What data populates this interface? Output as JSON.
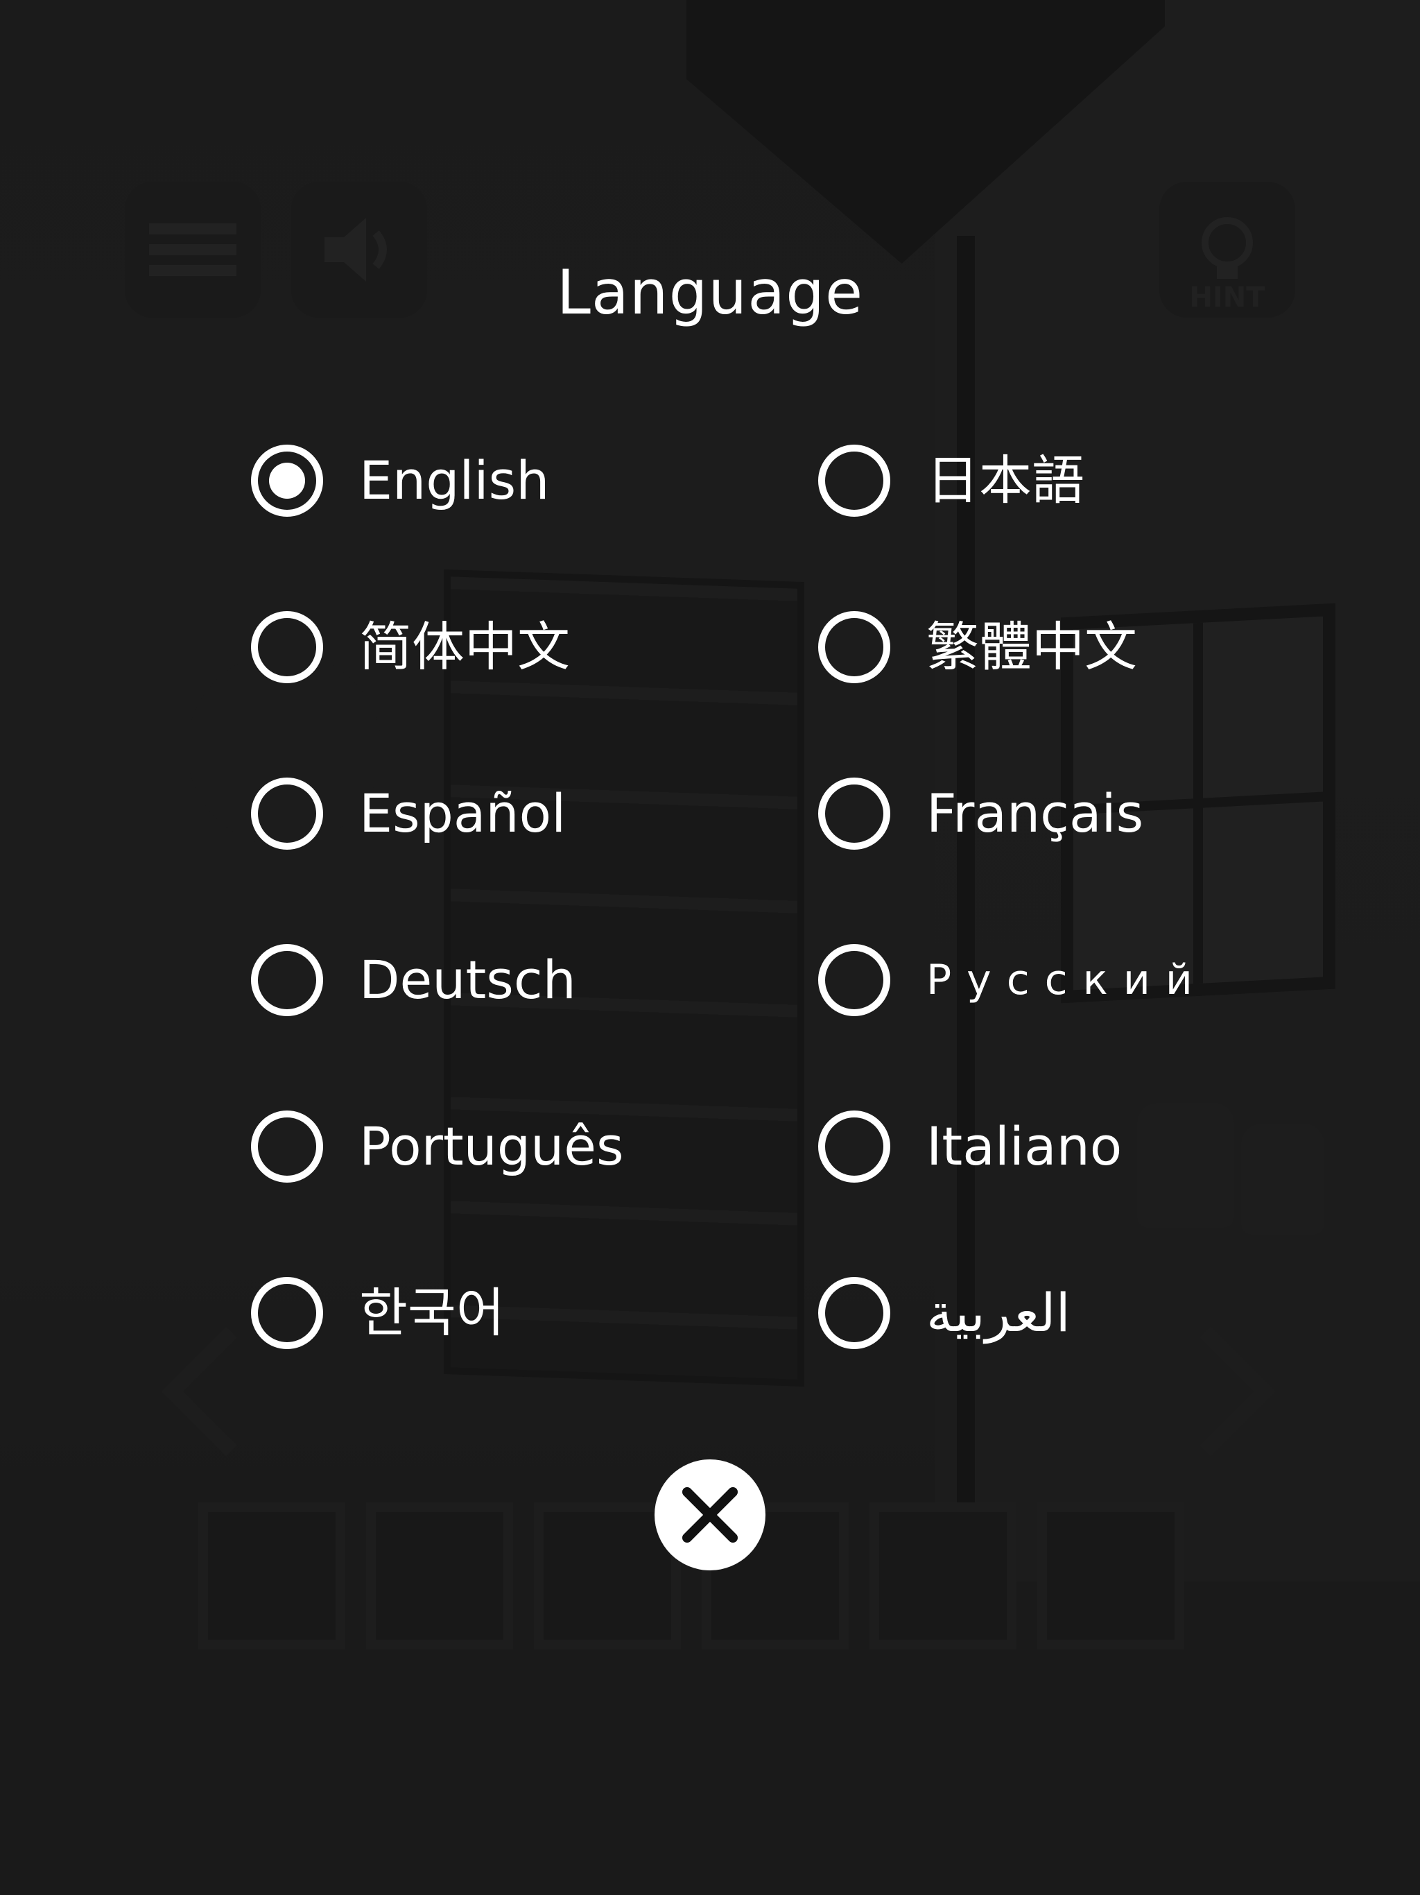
{
  "dialog": {
    "title": "Language",
    "languages": [
      {
        "label": "English",
        "selected": true
      },
      {
        "label": "日本語",
        "selected": false
      },
      {
        "label": "简体中文",
        "selected": false
      },
      {
        "label": "繁體中文",
        "selected": false
      },
      {
        "label": "Español",
        "selected": false
      },
      {
        "label": "Français",
        "selected": false
      },
      {
        "label": "Deutsch",
        "selected": false
      },
      {
        "label": "Русский",
        "selected": false
      },
      {
        "label": "Português",
        "selected": false
      },
      {
        "label": "Italiano",
        "selected": false
      },
      {
        "label": "한국어",
        "selected": false
      },
      {
        "label": "العربية",
        "selected": false
      }
    ],
    "close_icon": "close-icon"
  },
  "hud": {
    "hint_label": "HINT",
    "menu_icon": "menu-icon",
    "sound_icon": "speaker-icon",
    "hint_icon": "lightbulb-icon",
    "slot_count": 6
  },
  "colors": {
    "overlay_text": "#ffffff",
    "background": "#1e1e1e"
  }
}
